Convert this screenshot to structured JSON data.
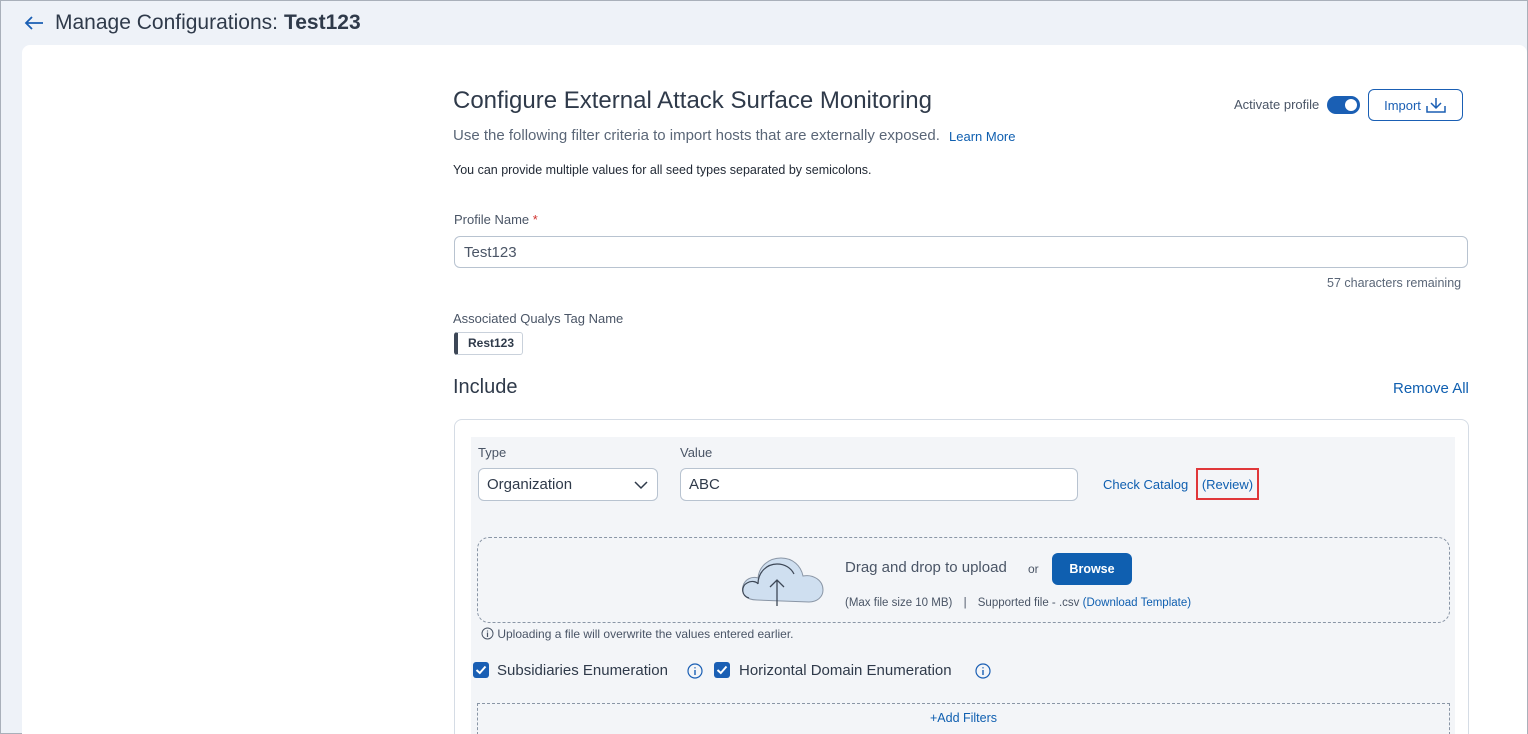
{
  "header": {
    "title": "Manage Configurations:",
    "config_name": "Test123"
  },
  "form": {
    "heading": "Configure External Attack Surface Monitoring",
    "subtitle": "Use the following filter criteria to import hosts that are externally exposed.",
    "learn_more": "Learn More",
    "note": "You can provide multiple values for all seed types separated by semicolons.",
    "activate_label": "Activate profile",
    "activate_on": true,
    "import_label": "Import",
    "profile_name_label": "Profile Name",
    "required_mark": "*",
    "profile_name_value": "Test123",
    "chars_remaining": "57 characters remaining",
    "tag_label": "Associated Qualys Tag Name",
    "tag_value": "Rest123"
  },
  "include": {
    "title": "Include",
    "remove_all": "Remove All",
    "type_label": "Type",
    "value_label": "Value",
    "type_selected": "Organization",
    "value": "ABC",
    "check_catalog": "Check Catalog",
    "review": "(Review)",
    "upload": {
      "drag_text": "Drag and drop to upload",
      "or": "or",
      "browse": "Browse",
      "max_size": "(Max file size 10 MB)",
      "separator": "|",
      "supported": "Supported file - .csv",
      "download_template": "(Download Template)",
      "overwrite_note": "Uploading a file will overwrite the values entered earlier."
    },
    "subsidiaries_label": "Subsidiaries Enumeration",
    "subsidiaries_checked": true,
    "horizontal_label": "Horizontal Domain Enumeration",
    "horizontal_checked": true,
    "add_filters": "Add Filters",
    "add_filters_prefix": "+"
  },
  "colors": {
    "accent": "#1a5fb4",
    "link": "#0f5fb0",
    "highlight_border": "#e0373a"
  }
}
